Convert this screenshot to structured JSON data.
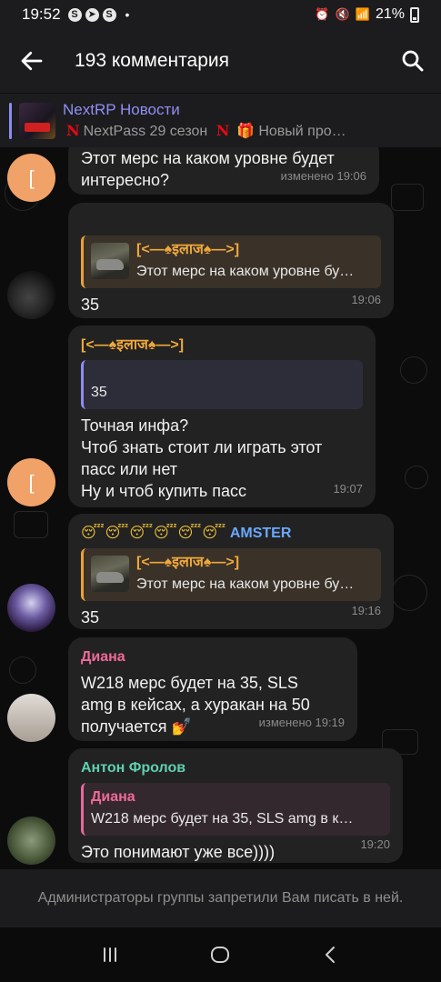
{
  "status": {
    "time": "19:52",
    "battery": "21%"
  },
  "header": {
    "title": "193 комментария"
  },
  "pinned": {
    "channel": "NextRP Новости",
    "preview_part1": "NextPass 29 сезон",
    "preview_part2": "Новый про…"
  },
  "messages": [
    {
      "text": "Этот мерс на каком уровне будет интересно?",
      "time": "изменено 19:06"
    },
    {
      "reply_name": "[<—♠इलाज♠—>]",
      "reply_text": "Этот мерс на каком уровне бу…",
      "text": "35",
      "time": "19:06"
    },
    {
      "sender": "[<—♠इलाज♠—>]",
      "reply_text": "35",
      "text_lines": [
        "Точная инфа?",
        "Чтоб знать стоит ли играть этот",
        "пасс или нет",
        "Ну и чтоб купить пасс"
      ],
      "time": "19:07"
    },
    {
      "sender_emoji": "😴😴😴😴😴😴",
      "sender": "AMSTER",
      "reply_name": "[<—♠इलाज♠—>]",
      "reply_text": "Этот мерс на каком уровне бу…",
      "text": "35",
      "time": "19:16"
    },
    {
      "sender": "Диана",
      "text_lines": [
        "W218 мерс будет на 35, SLS",
        "amg  в кейсах, а хуракан на 50",
        "получается 💅"
      ],
      "time": "изменено 19:19"
    },
    {
      "sender": "Антон Фролов",
      "reply_name": "Диана",
      "reply_text": "W218 мерс будет на 35, SLS amg  в к…",
      "text": "Это понимают уже все))))",
      "time": "19:20"
    }
  ],
  "avatar_initial": "[",
  "footer": {
    "notice": "Администраторы группы запретили Вам писать в ней."
  },
  "colors": {
    "accent": "#8c8cf0",
    "orange": "#f0a83c",
    "pink": "#f06a9a",
    "teal": "#5fd0b0",
    "blue": "#6aa8ff"
  }
}
